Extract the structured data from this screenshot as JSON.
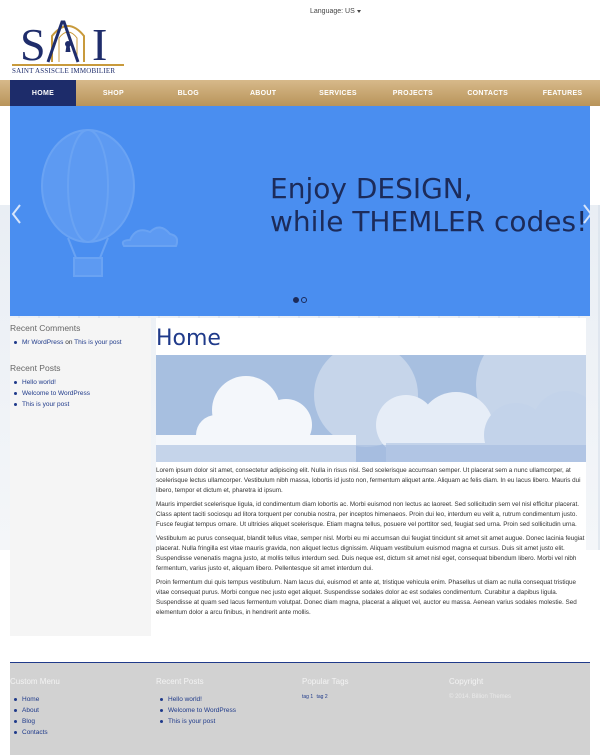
{
  "header": {
    "language_label": "Language: US",
    "logo_letters": "SAI",
    "logo_text": "SAINT ASSISCLE IMMOBILIER"
  },
  "nav": {
    "items": [
      "HOME",
      "SHOP",
      "BLOG",
      "ABOUT",
      "SERVICES",
      "PROJECTS",
      "CONTACTS",
      "FEATURES"
    ],
    "active_index": 0
  },
  "slider": {
    "line1": "Enjoy DESIGN,",
    "line2": "while THEMLER codes!",
    "slide_count": 2,
    "active_slide": 1
  },
  "sidebar": {
    "recent_comments_title": "Recent Comments",
    "comment": {
      "author": "Mr WordPress",
      "on": "on",
      "post": "This is your post"
    },
    "recent_posts_title": "Recent Posts",
    "posts": [
      "Hello world!",
      "Welcome to WordPress",
      "This is your post"
    ]
  },
  "main": {
    "title": "Home",
    "paragraphs": [
      "Lorem ipsum dolor sit amet, consectetur adipiscing elit. Nulla in risus nisl. Sed scelerisque accumsan semper. Ut placerat sem a nunc ullamcorper, at scelerisque lectus ullamcorper. Vestibulum nibh massa, lobortis id justo non, fermentum aliquet ante. Aliquam ac felis diam. In eu lacus libero. Mauris dui libero, tempor et dictum et, pharetra id ipsum.",
      "Mauris imperdiet scelerisque ligula, id condimentum diam lobortis ac. Morbi euismod non lectus ac laoreet. Sed sollicitudin sem vel nisl efficitur placerat. Class aptent taciti sociosqu ad litora torquent per conubia nostra, per inceptos himenaeos. Proin dui leo, interdum eu velit a, rutrum condimentum justo. Fusce feugiat tempus ornare. Ut ultricies aliquet scelerisque. Etiam magna tellus, posuere vel porttitor sed, feugiat sed urna. Proin sed sollicitudin urna.",
      "Vestibulum ac purus consequat, blandit tellus vitae, semper nisl. Morbi eu mi accumsan dui feugiat tincidunt sit amet sit amet augue. Donec lacinia feugiat placerat. Nulla fringilla est vitae mauris gravida, non aliquet lectus dignissim. Aliquam vestibulum euismod magna et cursus. Duis sit amet justo elit. Suspendisse venenatis magna justo, at mollis tellus interdum sed. Duis neque est, dictum sit amet nisl eget, consequat bibendum libero. Morbi vel nibh fermentum, varius justo et, aliquam libero. Pellentesque sit amet interdum dui.",
      "Proin fermentum dui quis tempus vestibulum. Nam lacus dui, euismod et ante at, tristique vehicula enim. Phasellus ut diam ac nulla consequat tristique vitae consequat purus. Morbi congue nec justo eget aliquet. Suspendisse sodales dolor ac est sodales condimentum. Curabitur a dapibus ligula. Suspendisse at quam sed lacus fermentum volutpat. Donec diam magna, placerat a aliquet vel, auctor eu massa. Aenean varius sodales molestie. Sed elementum dolor a arcu finibus, in hendrerit ante mollis."
    ]
  },
  "footer": {
    "custom_menu_title": "Custom Menu",
    "custom_menu": [
      "Home",
      "About",
      "Blog",
      "Contacts"
    ],
    "recent_posts_title": "Recent Posts",
    "recent_posts": [
      "Hello world!",
      "Welcome to WordPress",
      "This is your post"
    ],
    "popular_tags_title": "Popular Tags",
    "tags": [
      "tag 1",
      "tag 2"
    ],
    "copyright_title": "Copyright",
    "copyright_text": "© 2014. Billion Themes"
  },
  "colors": {
    "navy": "#1d2c6a",
    "gold": "#c89a3c",
    "slider_blue": "#4a8ef0",
    "link": "#1f3a8a"
  },
  "icons": {
    "slider_prev": "chevron-left-icon",
    "slider_next": "chevron-right-icon",
    "language_caret": "caret-down-icon"
  }
}
